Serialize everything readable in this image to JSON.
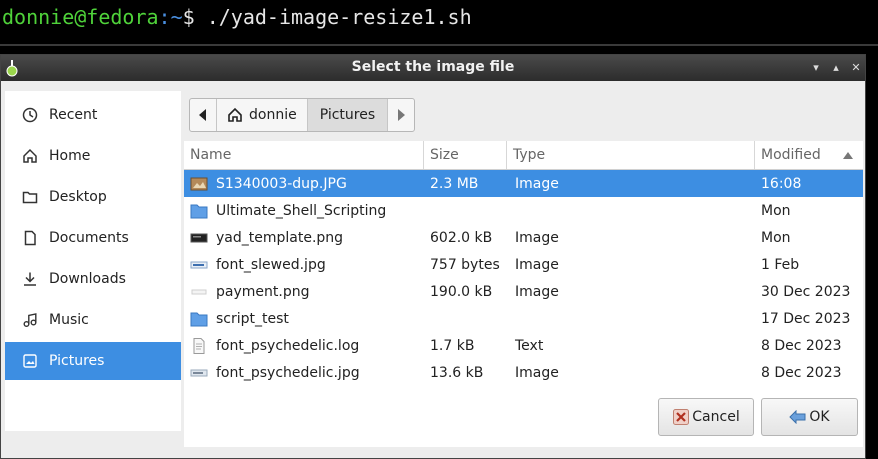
{
  "terminal": {
    "user_host": "donnie@fedora",
    "path": ":~",
    "command": "$ ./yad-image-resize1.sh"
  },
  "dialog": {
    "title": "Select the image file",
    "controls": {
      "minimize": "▾",
      "maximize": "▴",
      "close": "✕"
    }
  },
  "sidebar": {
    "items": [
      {
        "label": "Recent",
        "icon": "clock-icon"
      },
      {
        "label": "Home",
        "icon": "home-icon"
      },
      {
        "label": "Desktop",
        "icon": "folder-icon"
      },
      {
        "label": "Documents",
        "icon": "document-icon"
      },
      {
        "label": "Downloads",
        "icon": "download-icon"
      },
      {
        "label": "Music",
        "icon": "music-icon"
      },
      {
        "label": "Pictures",
        "icon": "picture-icon",
        "active": true
      }
    ]
  },
  "pathbar": {
    "home_label": "donnie",
    "current_label": "Pictures"
  },
  "columns": {
    "name": "Name",
    "size": "Size",
    "type": "Type",
    "modified": "Modified"
  },
  "files": [
    {
      "name": "S1340003-dup.JPG",
      "size": "2.3 MB",
      "type": "Image",
      "modified": "16:08",
      "icon": "image-file-icon",
      "selected": true
    },
    {
      "name": "Ultimate_Shell_Scripting",
      "size": "",
      "type": "",
      "modified": "Mon",
      "icon": "folder-icon"
    },
    {
      "name": "yad_template.png",
      "size": "602.0 kB",
      "type": "Image",
      "modified": "Mon",
      "icon": "image-file-icon"
    },
    {
      "name": "font_slewed.jpg",
      "size": "757 bytes",
      "type": "Image",
      "modified": "1 Feb",
      "icon": "image-file-icon"
    },
    {
      "name": "payment.png",
      "size": "190.0 kB",
      "type": "Image",
      "modified": "30 Dec 2023",
      "icon": "image-file-icon"
    },
    {
      "name": "script_test",
      "size": "",
      "type": "",
      "modified": "17 Dec 2023",
      "icon": "folder-icon"
    },
    {
      "name": "font_psychedelic.log",
      "size": "1.7 kB",
      "type": "Text",
      "modified": "8 Dec 2023",
      "icon": "text-file-icon"
    },
    {
      "name": "font_psychedelic.jpg",
      "size": "13.6 kB",
      "type": "Image",
      "modified": "8 Dec 2023",
      "icon": "image-file-icon"
    }
  ],
  "buttons": {
    "cancel": "Cancel",
    "ok": "OK"
  },
  "colors": {
    "accent": "#3d8ee2",
    "terminal_user": "#4fd23a",
    "terminal_path": "#4a8fe0"
  }
}
